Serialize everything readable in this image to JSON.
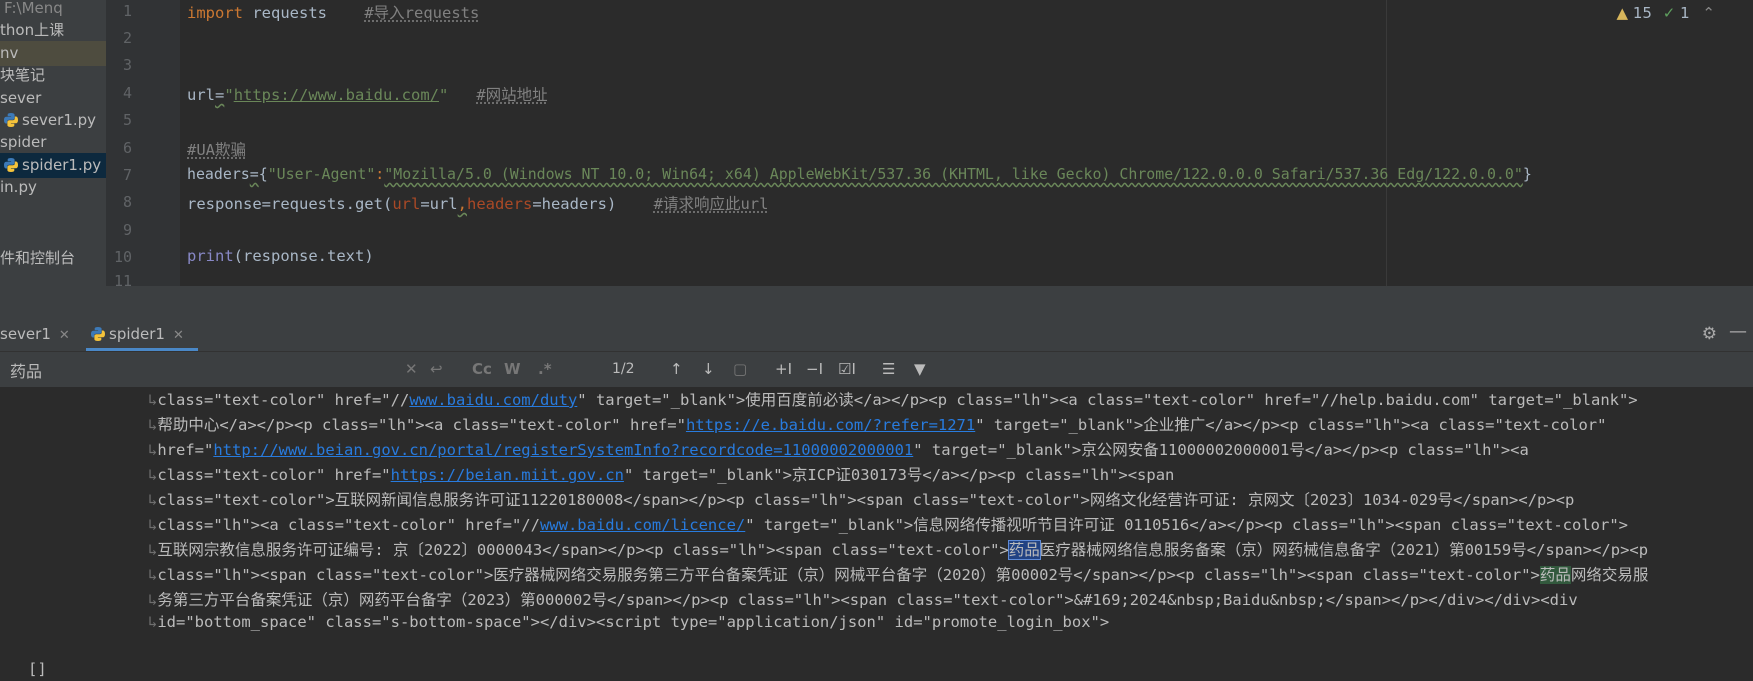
{
  "sidebar": {
    "items": [
      {
        "label": "F:\\Menq"
      },
      {
        "label": "thon上课"
      },
      {
        "label": "nv"
      },
      {
        "label": "块笔记"
      },
      {
        "label": "sever"
      },
      {
        "label": "sever1.py"
      },
      {
        "label": "spider"
      },
      {
        "label": "spider1.py"
      },
      {
        "label": "in.py"
      },
      {
        "label": "件和控制台"
      }
    ]
  },
  "editor": {
    "line_numbers": [
      "1",
      "2",
      "3",
      "4",
      "5",
      "6",
      "7",
      "8",
      "9",
      "10",
      "11"
    ],
    "line1": {
      "kw": "import",
      "mod": " requests",
      "comment": "#导入requests"
    },
    "line4": {
      "var": "url",
      "eq": "=",
      "q1": "\"",
      "url": "https://www.baidu.com/",
      "q2": "\"",
      "comment": "#网站地址"
    },
    "line6": {
      "comment": "#UA欺骗"
    },
    "line7": {
      "var": "headers",
      "eq": "=",
      "brace_open": "{",
      "key": "\"User-Agent\"",
      "colon": ":",
      "value": "\"Mozilla/5.0 (Windows NT 10.0; Win64; x64) AppleWebKit/537.36 (KHTML, like Gecko) Chrome/122.0.0.0 Safari/537.36 Edg/122.0.0.0\"",
      "brace_close": "}"
    },
    "line8": {
      "a": "response",
      "b": "=requests.get(",
      "k1": "url",
      "c": "=url",
      "comma": ",",
      "k2": "headers",
      "d": "=headers)",
      "comment": "#请求响应此url"
    },
    "line10": {
      "fn": "print",
      "rest": "(response.text)"
    },
    "inspections": {
      "warnings": "15",
      "ok": "1"
    }
  },
  "run_tabs": [
    {
      "label": "sever1"
    },
    {
      "label": "spider1"
    }
  ],
  "search": {
    "query": "药品",
    "match_count": "1/2",
    "cc": "Cc",
    "w": "W",
    "regex": ".*"
  },
  "console": {
    "l1": {
      "a": "class=\"text-color\" href=\"//",
      "link": "www.baidu.com/duty",
      "b": "\" target=\"_blank\">使用百度前必读</a></p><p class=\"lh\"><a class=\"text-color\" href=\"//help.baidu.com\" target=\"_blank\">"
    },
    "l2": {
      "a": "帮助中心</a></p><p class=\"lh\"><a class=\"text-color\" href=\"",
      "link": "https://e.baidu.com/?refer=1271",
      "b": "\" target=\"_blank\">企业推广</a></p><p class=\"lh\"><a class=\"text-color\""
    },
    "l3": {
      "a": "href=\"",
      "link": "http://www.beian.gov.cn/portal/registerSystemInfo?recordcode=11000002000001",
      "b": "\" target=\"_blank\">京公网安备11000002000001号</a></p><p class=\"lh\"><a"
    },
    "l4": {
      "a": "class=\"text-color\" href=\"",
      "link": "https://beian.miit.gov.cn",
      "b": "\" target=\"_blank\">京ICP证030173号</a></p><p class=\"lh\"><span"
    },
    "l5": {
      "a": "class=\"text-color\">互联网新闻信息服务许可证11220180008</span></p><p class=\"lh\"><span class=\"text-color\">网络文化经营许可证: 京网文〔2023〕1034-029号</span></p><p"
    },
    "l6": {
      "a": "class=\"lh\"><a class=\"text-color\" href=\"//",
      "link": "www.baidu.com/licence/",
      "b": "\" target=\"_blank\">信息网络传播视听节目许可证 0110516</a></p><p class=\"lh\"><span class=\"text-color\">"
    },
    "l7": {
      "a": "互联网宗教信息服务许可证编号: 京〔2022〕0000043</span></p><p class=\"lh\"><span class=\"text-color\">",
      "hl": "药品",
      "b": "医疗器械网络信息服务备案（京）网药械信息备字（2021）第00159号</span></p><p"
    },
    "l8": {
      "a": "class=\"lh\"><span class=\"text-color\">医疗器械网络交易服务第三方平台备案凭证（京）网械平台备字（2020）第00002号</span></p><p class=\"lh\"><span class=\"text-color\">",
      "hl": "药品",
      "b": "网络交易服"
    },
    "l9": {
      "a": "务第三方平台备案凭证（京）网药平台备字（2023）第000002号</span></p><p class=\"lh\"><span class=\"text-color\">&#169;2024&nbsp;Baidu&nbsp;</span></p></div></div><div"
    },
    "l10": {
      "a": "id=\"bottom_space\" class=\"s-bottom-space\"></div><script type=\"application/json\" id=\"promote_login_box\">"
    },
    "prompt": "[]"
  },
  "colors": {
    "editor_bg": "#2b2b2b",
    "panel_bg": "#3c3f41",
    "keyword": "#cc7832",
    "string": "#6a8759",
    "comment": "#808080",
    "link": "#287bde",
    "accent": "#4a88c7"
  }
}
